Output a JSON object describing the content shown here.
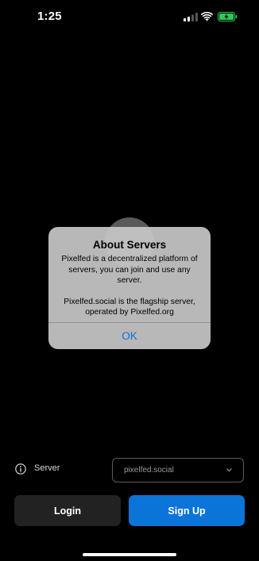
{
  "status_bar": {
    "time": "1:25",
    "icons": [
      "signal-icon",
      "wifi-icon",
      "battery-charging-icon"
    ],
    "battery_color": "#33c759"
  },
  "alert": {
    "title": "About Servers",
    "message_1": "Pixelfed is a decentralized platform of servers, you can join and use any server.",
    "message_2": "Pixelfed.social is the flagship server, operated by Pixelfed.org",
    "ok_label": "OK",
    "accent_color": "#0a72d8"
  },
  "server": {
    "label": "Server",
    "selected": "pixelfed.social",
    "icon": "info-icon"
  },
  "buttons": {
    "login_label": "Login",
    "signup_label": "Sign Up",
    "signup_color": "#0b74d9"
  }
}
